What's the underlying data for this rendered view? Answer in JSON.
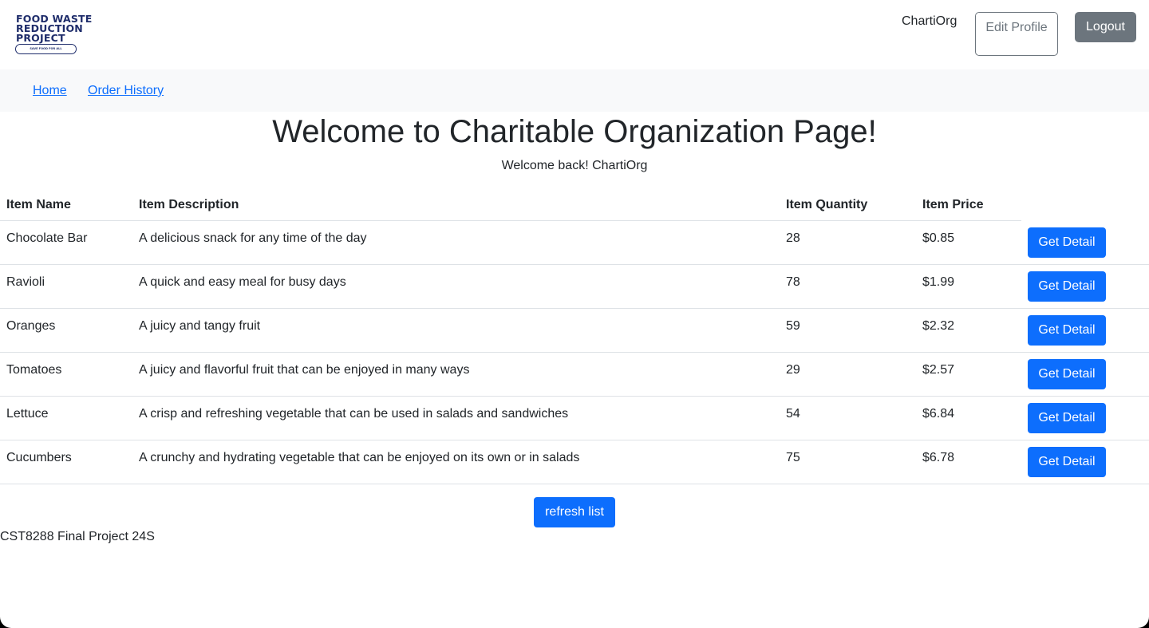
{
  "brand": {
    "lines": [
      "FOOD WASTE",
      "REDUCTION",
      "PROJECT"
    ],
    "tagline": "SAVE FOOD FOR ALL"
  },
  "header": {
    "user_name": "ChartiOrg",
    "edit_profile_label": "Edit Profile",
    "logout_label": "Logout"
  },
  "nav": {
    "items": [
      {
        "label": "Home"
      },
      {
        "label": "Order History"
      }
    ]
  },
  "main": {
    "title": "Welcome to Charitable Organization Page!",
    "welcome": "Welcome back! ChartiOrg"
  },
  "table": {
    "columns": [
      "Item Name",
      "Item Description",
      "Item Quantity",
      "Item Price"
    ],
    "action_label": "Get Detail",
    "rows": [
      {
        "name": "Chocolate Bar",
        "description": "A delicious snack for any time of the day",
        "quantity": "28",
        "price": "$0.85"
      },
      {
        "name": "Ravioli",
        "description": "A quick and easy meal for busy days",
        "quantity": "78",
        "price": "$1.99"
      },
      {
        "name": "Oranges",
        "description": "A juicy and tangy fruit",
        "quantity": "59",
        "price": "$2.32"
      },
      {
        "name": "Tomatoes",
        "description": "A juicy and flavorful fruit that can be enjoyed in many ways",
        "quantity": "29",
        "price": "$2.57"
      },
      {
        "name": "Lettuce",
        "description": "A crisp and refreshing vegetable that can be used in salads and sandwiches",
        "quantity": "54",
        "price": "$6.84"
      },
      {
        "name": "Cucumbers",
        "description": "A crunchy and hydrating vegetable that can be enjoyed on its own or in salads",
        "quantity": "75",
        "price": "$6.78"
      }
    ]
  },
  "refresh_label": "refresh list",
  "footer": {
    "text": "CST8288 Final Project 24S"
  },
  "colors": {
    "primary": "#0d6efd",
    "secondary": "#6c757d",
    "brand": "#1f2d6b",
    "nav_bg": "#f8f9fa"
  }
}
